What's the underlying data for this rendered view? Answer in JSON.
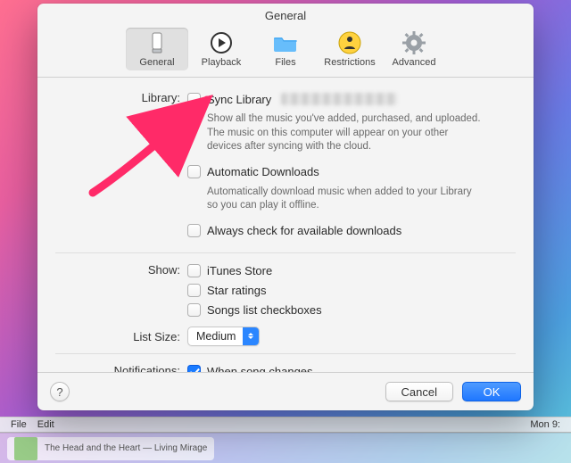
{
  "window": {
    "title": "General"
  },
  "toolbar": {
    "items": [
      {
        "id": "general",
        "label": "General"
      },
      {
        "id": "playback",
        "label": "Playback"
      },
      {
        "id": "files",
        "label": "Files"
      },
      {
        "id": "restrictions",
        "label": "Restrictions"
      },
      {
        "id": "advanced",
        "label": "Advanced"
      }
    ],
    "selected": "general"
  },
  "sections": {
    "library": {
      "label": "Library:",
      "sync": {
        "label": "Sync Library",
        "checked": false,
        "description": "Show all the music you've added, purchased, and uploaded. The music on this computer will appear on your other devices after syncing with the cloud."
      },
      "auto_dl": {
        "label": "Automatic Downloads",
        "checked": false,
        "description": "Automatically download music when added to your Library so you can play it offline."
      },
      "always_check": {
        "label": "Always check for available downloads",
        "checked": false
      }
    },
    "show": {
      "label": "Show:",
      "itunes_store": {
        "label": "iTunes Store",
        "checked": false
      },
      "star_ratings": {
        "label": "Star ratings",
        "checked": false
      },
      "song_checkboxes": {
        "label": "Songs list checkboxes",
        "checked": false
      }
    },
    "list_size": {
      "label": "List Size:",
      "value": "Medium"
    },
    "notifications": {
      "label": "Notifications:",
      "when_song_changes": {
        "label": "When song changes",
        "checked": true
      }
    }
  },
  "buttons": {
    "help": "?",
    "cancel": "Cancel",
    "ok": "OK"
  },
  "menubar": {
    "file": "File",
    "edit": "Edit",
    "clock": "Mon 9:"
  },
  "dock": {
    "now_playing": "The Head and the Heart — Living Mirage"
  }
}
